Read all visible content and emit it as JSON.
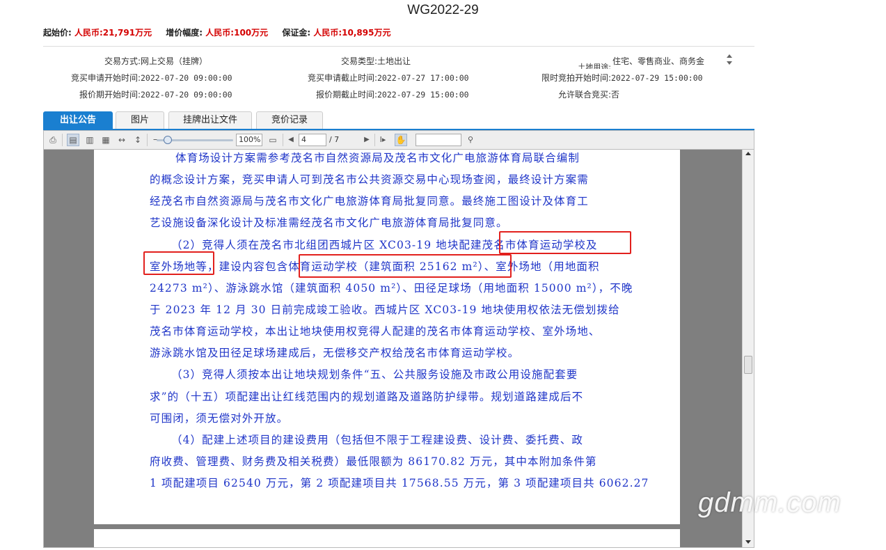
{
  "title": "WG2022-29",
  "prices": {
    "start_label": "起始价:",
    "start_value": "人民币:21,791万元",
    "step_label": "增价幅度:",
    "step_value": "人民币:100万元",
    "deposit_label": "保证金:",
    "deposit_value": "人民币:10,895万元"
  },
  "info": {
    "trade_mode_label": "交易方式:",
    "trade_mode_value": "网上交易（挂牌）",
    "trade_type_label": "交易类型:",
    "trade_type_value": "土地出让",
    "land_use_label": "土地用途:",
    "land_use_value": "住宅、零售商业、商务金",
    "apply_start_label": "竞买申请开始时间:",
    "apply_start_value": "2022-07-20 09:00:00",
    "apply_end_label": "竞买申请截止时间:",
    "apply_end_value": "2022-07-27 17:00:00",
    "auction_start_label": "限时竞拍开始时间:",
    "auction_start_value": "2022-07-29 15:00:00",
    "quote_start_label": "报价期开始时间:",
    "quote_start_value": "2022-07-20 09:00:00",
    "quote_end_label": "报价期截止时间:",
    "quote_end_value": "2022-07-29 15:00:00",
    "joint_label": "允许联合竞买:",
    "joint_value": "否"
  },
  "tabs": [
    "出让公告",
    "图片",
    "挂牌出让文件",
    "竞价记录"
  ],
  "toolbar": {
    "zoom": "100%",
    "page_current": "4",
    "page_total": "/ 7",
    "search_value": ""
  },
  "document_lines": [
    "体育场设计方案需参考茂名市自然资源局及茂名市文化广电旅游体育局联合编制",
    "的概念设计方案，竞买申请人可到茂名市公共资源交易中心现场查阅，最终设计方案需",
    "经茂名市自然资源局与茂名市文化广电旅游体育局批复同意。最终施工图设计及体育工",
    "艺设施设备深化设计及标准需经茂名市文化广电旅游体育局批复同意。",
    "（2）竞得人须在茂名市北组团西城片区 XC03-19 地块配建茂名市体育运动学校及",
    "室外场地等，建设内容包含体育运动学校（建筑面积 25162 m²）、室外场地（用地面积",
    "24273 m²）、游泳跳水馆（建筑面积 4050 m²）、田径足球场（用地面积 15000 m²），不晚",
    "于 2023 年 12 月 30 日前完成竣工验收。西城片区 XC03-19 地块使用权依法无偿划拨给",
    "茂名市体育运动学校，本出让地块使用权竞得人配建的茂名市体育运动学校、室外场地、",
    "游泳跳水馆及田径足球场建成后，无偿移交产权给茂名市体育运动学校。",
    "（3）竞得人须按本出让地块规划条件“五、公共服务设施及市政公用设施配套要",
    "求”的（十五）项配建出让红线范围内的规划道路及道路防护绿带。规划道路建成后不",
    "可围闭，须无偿对外开放。",
    "（4）配建上述项目的建设费用（包括但不限于工程建设费、设计费、委托费、政",
    "府收费、管理费、财务费及相关税费）最低限额为 86170.82 万元，其中本附加条件第",
    "1 项配建项目 62540 万元，第 2 项配建项目共 17568.55 万元，第 3 项配建项目共 6062.27"
  ],
  "watermark": "gdmm.com",
  "colors": {
    "accent": "#1a7fd0",
    "price_red": "#d40000",
    "doc_text": "#1f35c8",
    "highlight": "#e2201d"
  }
}
